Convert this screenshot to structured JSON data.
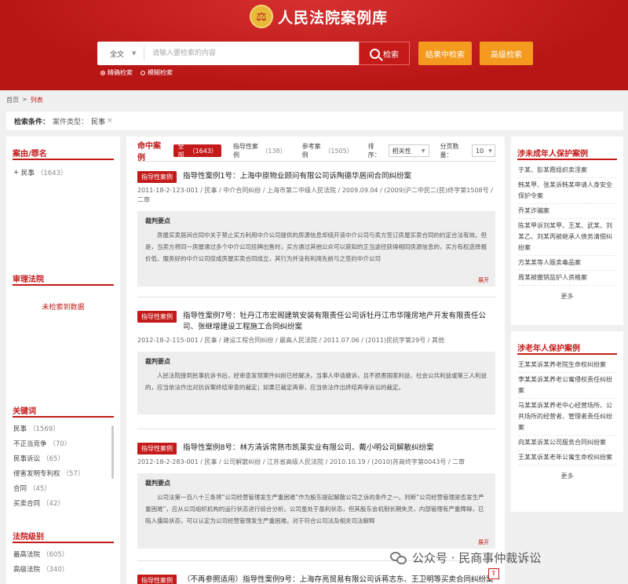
{
  "header": {
    "title": "人民法院案例库",
    "search": {
      "scope": "全文",
      "placeholder": "请输入要检索的内容"
    },
    "btn_search": "检索",
    "btn_in_result": "结果中检索",
    "btn_advanced": "高级检索",
    "modes": [
      "精确检索",
      "模糊检索"
    ]
  },
  "breadcrumb": {
    "home": "首页",
    "sep": ">",
    "current": "列表"
  },
  "condition": {
    "label": "检索条件：",
    "type": "案件类型：",
    "value": "民事",
    "remove": "×"
  },
  "left": {
    "cause": {
      "title": "案由/罪名",
      "items": [
        {
          "prefix": "+",
          "label": "民事",
          "count": "（1643）"
        }
      ]
    },
    "court": {
      "title": "审理法院",
      "empty": "未检索到数据"
    },
    "keywords": {
      "title": "关键词",
      "items": [
        {
          "label": "民事",
          "count": "（1569）"
        },
        {
          "label": "不正当竞争",
          "count": "（70）"
        },
        {
          "label": "民事诉讼",
          "count": "（65）"
        },
        {
          "label": "侵害发明专利权",
          "count": "（57）"
        },
        {
          "label": "合同",
          "count": "（45）"
        },
        {
          "label": "买卖合同",
          "count": "（42）"
        }
      ]
    },
    "court_level": {
      "title": "法院级别",
      "items": [
        {
          "label": "最高法院",
          "count": "（605）"
        },
        {
          "label": "高级法院",
          "count": "（340）"
        }
      ]
    }
  },
  "main": {
    "hit_title": "命中案例",
    "tabs": [
      {
        "label": "全部",
        "count": "（1643）"
      },
      {
        "label": "指导性案例",
        "count": "（138）"
      },
      {
        "label": "参考案例",
        "count": "（1505）"
      }
    ],
    "sort_label": "排序：",
    "sort_value": "相关性",
    "page_size_label": "分页数量：",
    "page_size_value": "10",
    "cases": [
      {
        "badge": "指导性案例",
        "title": "指导性案例1号：上海中原物业顾问有限公司诉陶德华居间合同纠纷案",
        "meta": "2011-18-2-123-001 / 民事 / 中介合同纠纷 / 上海市第二中级人民法院 / 2009.09.04 / (2009)沪二中民二(民)终字第1508号 / 二审",
        "kp_label": "裁判要点",
        "text": "房屋买卖居间合同中关于禁止买方利用中介公司提供的房源信息却绕开该中介公司与卖方签订房屋买卖合同的约定合法有效。但是，当卖方将同一房屋通过多个中介公司挂牌出售时，买方通过其他公众可以获知的正当途径获得相同房源信息的，买方有权选择报价低、服务好的中介公司促成房屋买卖合同成立，其行为并没有利用先前与之签约中介公司",
        "expand": "展开"
      },
      {
        "badge": "指导性案例",
        "title": "指导性案例7号：牡丹江市宏阁建筑安装有限责任公司诉牡丹江市华隆房地产开发有限责任公司、张继增建设工程施工合同纠纷案",
        "meta": "2012-18-2-115-001 / 民事 / 建设工程合同纠纷 / 最高人民法院 / 2011.07.06 / (2011)民抗字第29号 / 其他",
        "kp_label": "裁判要点",
        "text": "人民法院接到民事抗诉书后，经审查发现案件纠纷已经解决，当事人申请撤诉，且不损害国家利益、社会公共利益或第三人利益的，应当依法作出对抗诉案终结审查的裁定；如果已裁定再审，应当依法作出终结再审诉讼的裁定。",
        "expand": ""
      },
      {
        "badge": "指导性案例",
        "title": "指导性案例8号：林方清诉常熟市凯莱实业有限公司、戴小明公司解散纠纷案",
        "meta": "2012-18-2-283-001 / 民事 / 公司解散纠纷 / 江苏省高级人民法院 / 2010.10.19 / (2010)苏商终字第0043号 / 二审",
        "kp_label": "裁判要点",
        "text": "公司法第一百八十三条将“公司经营管理发生严重困难”作为股东提起解散公司之诉的条件之一。判断“公司经营管理是否发生严重困难”，应从公司组织机构的运行状态进行综合分析。公司虽处于盈利状态，但其股东会机制长期失灵，内部管理有严重障碍，已陷入僵局状态，可以认定为公司经营管理发生严重困难。对于符合公司法及相关司法解释",
        "expand": "展开"
      },
      {
        "badge": "指导性案例",
        "title": "（不再参照适用）指导性案例9号：上海存亮贸易有限公司诉蒋志东、王卫明等买卖合同纠纷案",
        "meta": "",
        "kp_label": "",
        "text": "",
        "expand": ""
      }
    ]
  },
  "right": {
    "minor": {
      "title": "涉未成年人保护案例",
      "items": [
        "于某、彭某霞组织卖淫案",
        "韩某甲、张某诉韩某申请人身安全保护令案",
        "乔某诈骗案",
        "陈某甲诉刘某甲、王某、武某、刘某乙、刘某丙被继承人债务清偿纠纷案",
        "方某某等人贩卖毒品案",
        "周某被撤销监护人资格案"
      ],
      "more": "更多"
    },
    "elder": {
      "title": "涉老年人保护案例",
      "items": [
        "王某某诉某养老院生命权纠纷案",
        "李某某诉某养老公寓侵权责任纠纷案",
        "马某某诉某养老中心经营场所、公共场所的经营者、管理者责任纠纷案",
        "向某某诉某公司服务合同纠纷案",
        "王某某诉某老年公寓生命权纠纷案"
      ],
      "more": "更多"
    }
  },
  "watermark": {
    "text": "公众号 · 民商事仲裁诉讼"
  }
}
